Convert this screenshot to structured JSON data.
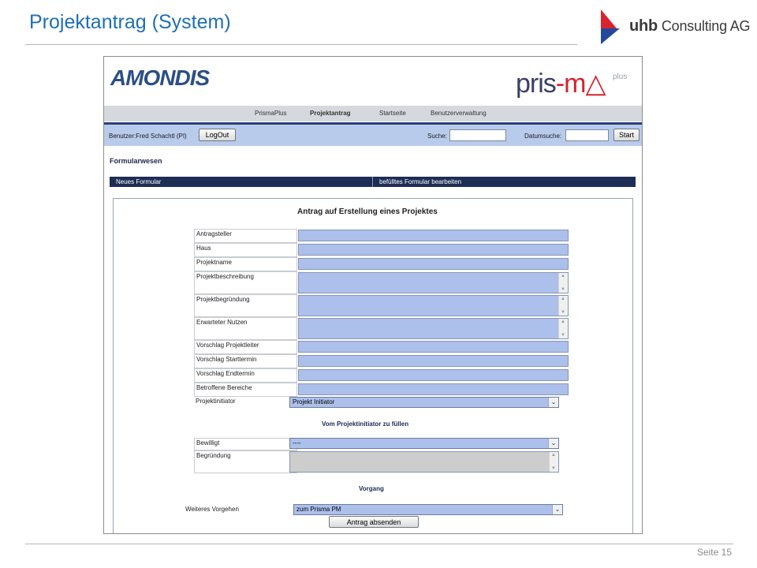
{
  "slide": {
    "title": "Projektantrag (System)",
    "page_number": "Seite 15",
    "logo_brand_bold": "uhb",
    "logo_brand_rest": "Consulting AG"
  },
  "app": {
    "logo_left": "AMONDIS",
    "logo_right_a": "pris",
    "logo_right_b": "-m",
    "logo_right_c": "△",
    "logo_right_plus": "plus",
    "nav": {
      "items": [
        "PrismaPlus",
        "Projektantrag",
        "Startseite",
        "Benutzerverwaltung"
      ],
      "active": "Projektantrag"
    },
    "userbar": {
      "user_label": "Benutzer:Fred Schachtl (PI)",
      "logout": "LogOut",
      "search_label": "Suche:",
      "date_search_label": "Datumsuche:",
      "start": "Start"
    },
    "section_title": "Formularwesen",
    "tabs": [
      "Neues Formular",
      "befülltes Formular bearbeiten"
    ],
    "form": {
      "title": "Antrag auf Erstellung eines Projektes",
      "fields": [
        {
          "label": "Antragsteller",
          "type": "text",
          "value": ""
        },
        {
          "label": "Haus",
          "type": "text",
          "value": ""
        },
        {
          "label": "Projektname",
          "type": "text",
          "value": ""
        },
        {
          "label": "Projektbeschreibung",
          "type": "textarea",
          "value": ""
        },
        {
          "label": "Projektbegründung",
          "type": "textarea",
          "value": ""
        },
        {
          "label": "Erwarteter Nutzen",
          "type": "textarea",
          "value": ""
        },
        {
          "label": "Vorschlag Projektleiter",
          "type": "text",
          "value": ""
        },
        {
          "label": "Vorschlag Starttermin",
          "type": "text",
          "value": ""
        },
        {
          "label": "Vorschlag Endtermin",
          "type": "text",
          "value": ""
        },
        {
          "label": "Betroffene Bereiche",
          "type": "text",
          "value": ""
        },
        {
          "label": "Projektinitiator",
          "type": "select",
          "value": "Projekt Initiator"
        }
      ],
      "initiator_section": "Vom Projektinitiator zu füllen",
      "approval_fields": [
        {
          "label": "Bewilligt",
          "type": "select",
          "value": "----"
        },
        {
          "label": "Begründung",
          "type": "textarea-disabled",
          "value": ""
        }
      ],
      "process_section": "Vorgang",
      "next_step_label": "Weiteres Vorgehen",
      "next_step_value": "zum Prisma PM",
      "submit": "Antrag absenden"
    }
  }
}
